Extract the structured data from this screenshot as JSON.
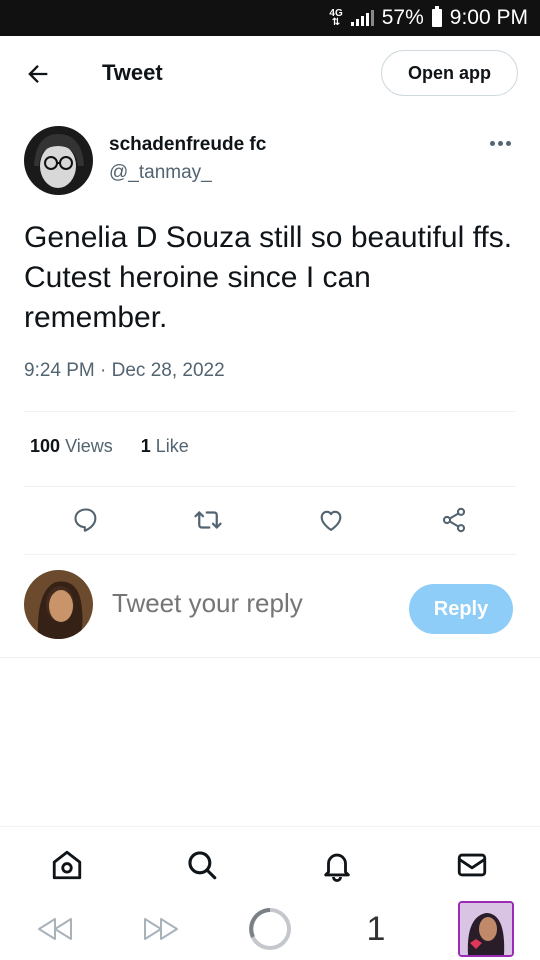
{
  "status_bar": {
    "network": "4G",
    "battery": "57%",
    "time": "9:00 PM"
  },
  "header": {
    "title": "Tweet",
    "open_app_label": "Open app"
  },
  "tweet": {
    "display_name": "schadenfreude fc",
    "handle": "@_tanmay_",
    "text": "Genelia D Souza still so beautiful ffs. Cutest heroine since I can remember.",
    "timestamp": "9:24 PM · Dec 28, 2022",
    "views_count": "100",
    "views_label": "Views",
    "likes_count": "1",
    "likes_label": "Like"
  },
  "reply": {
    "placeholder": "Tweet your reply",
    "button_label": "Reply"
  },
  "browser": {
    "tab_count": "1"
  },
  "colors": {
    "accent": "#1d9bf0",
    "reply_button": "#8ecdf8",
    "secondary_text": "#536471"
  },
  "icons": {
    "actions": [
      "reply-icon",
      "retweet-icon",
      "like-icon",
      "share-icon"
    ],
    "nav": [
      "home-icon",
      "search-icon",
      "notifications-icon",
      "messages-icon"
    ]
  }
}
